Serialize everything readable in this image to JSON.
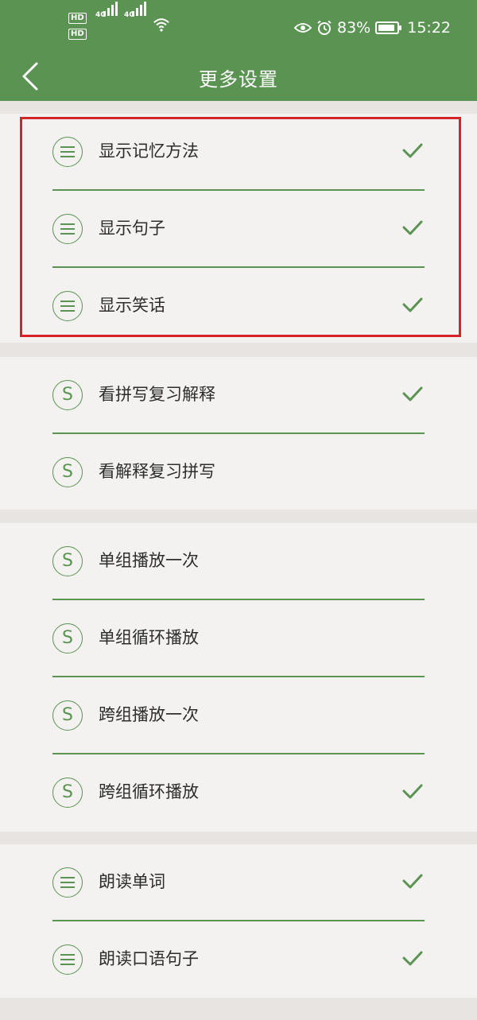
{
  "status_bar": {
    "hd1": "HD",
    "hd2": "HD",
    "net1": "4G",
    "net2": "4G",
    "battery_pct": "83%",
    "time": "15:22",
    "icons": [
      "eye-icon",
      "alarm-icon",
      "battery-charging-icon",
      "wifi-icon",
      "signal-icon"
    ]
  },
  "header": {
    "title": "更多设置",
    "back_icon": "chevron-left-icon"
  },
  "colors": {
    "accent": "#5b9353",
    "highlight": "#d8222a",
    "background": "#e8e4e2",
    "card": "#f3f2f0"
  },
  "groups": [
    {
      "items": [
        {
          "label": "显示记忆方法",
          "icon": "menu-lines-icon",
          "checked": true
        },
        {
          "label": "显示句子",
          "icon": "menu-lines-icon",
          "checked": true
        },
        {
          "label": "显示笑话",
          "icon": "menu-lines-icon",
          "checked": true
        }
      ]
    },
    {
      "items": [
        {
          "label": "看拼写复习解释",
          "icon": "s-circle-icon",
          "checked": true
        },
        {
          "label": "看解释复习拼写",
          "icon": "s-circle-icon",
          "checked": false
        }
      ]
    },
    {
      "items": [
        {
          "label": "单组播放一次",
          "icon": "s-circle-icon",
          "checked": false
        },
        {
          "label": "单组循环播放",
          "icon": "s-circle-icon",
          "checked": false
        },
        {
          "label": "跨组播放一次",
          "icon": "s-circle-icon",
          "checked": false
        },
        {
          "label": "跨组循环播放",
          "icon": "s-circle-icon",
          "checked": true
        }
      ]
    },
    {
      "items": [
        {
          "label": "朗读单词",
          "icon": "menu-lines-icon",
          "checked": true
        },
        {
          "label": "朗读口语句子",
          "icon": "menu-lines-icon",
          "checked": true
        }
      ]
    }
  ]
}
